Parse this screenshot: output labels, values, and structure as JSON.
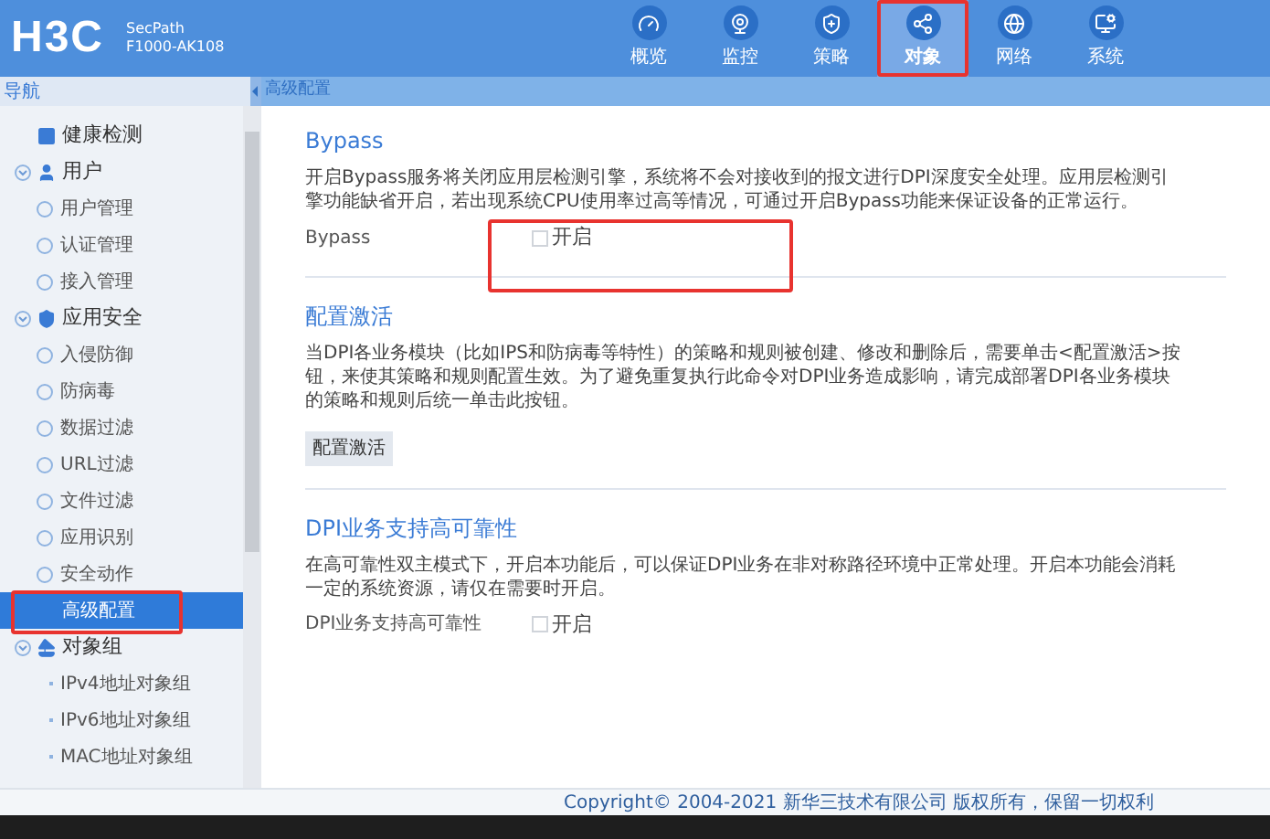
{
  "brand": {
    "logo": "H3C",
    "product_line": "SecPath",
    "model": "F1000-AK108"
  },
  "nav_tabs": [
    {
      "label": "概览",
      "selected": false
    },
    {
      "label": "监控",
      "selected": false
    },
    {
      "label": "策略",
      "selected": false
    },
    {
      "label": "对象",
      "selected": true
    },
    {
      "label": "网络",
      "selected": false
    },
    {
      "label": "系统",
      "selected": false
    }
  ],
  "sidebar": {
    "title": "导航",
    "items": [
      {
        "label": "健康检测",
        "selected": false
      },
      {
        "label": "用户",
        "expanded": true,
        "selected": false,
        "children": [
          {
            "label": "用户管理",
            "selected": false
          },
          {
            "label": "认证管理",
            "selected": false
          },
          {
            "label": "接入管理",
            "selected": false
          }
        ]
      },
      {
        "label": "应用安全",
        "expanded": true,
        "selected": false,
        "children": [
          {
            "label": "入侵防御",
            "selected": false
          },
          {
            "label": "防病毒",
            "selected": false
          },
          {
            "label": "数据过滤",
            "selected": false
          },
          {
            "label": "URL过滤",
            "selected": false
          },
          {
            "label": "文件过滤",
            "selected": false
          },
          {
            "label": "应用识别",
            "selected": false
          },
          {
            "label": "安全动作",
            "selected": false
          },
          {
            "label": "高级配置",
            "selected": true
          }
        ]
      },
      {
        "label": "对象组",
        "expanded": true,
        "selected": false,
        "children": [
          {
            "label": "IPv4地址对象组",
            "selected": false
          },
          {
            "label": "IPv6地址对象组",
            "selected": false
          },
          {
            "label": "MAC地址对象组",
            "selected": false
          }
        ]
      }
    ]
  },
  "breadcrumb": "高级配置",
  "sections": [
    {
      "title": "Bypass",
      "description": "开启Bypass服务将关闭应用层检测引擎，系统将不会对接收到的报文进行DPI深度安全处理。应用层检测引擎功能缺省开启，若出现系统CPU使用率过高等情况，可通过开启Bypass功能来保证设备的正常运行。",
      "kind": "checkbox",
      "field_label": "Bypass",
      "option": "开启",
      "checked": false
    },
    {
      "title": "配置激活",
      "description": "当DPI各业务模块（比如IPS和防病毒等特性）的策略和规则被创建、修改和删除后，需要单击<配置激活>按钮，来使其策略和规则配置生效。为了避免重复执行此命令对DPI业务造成影响，请完成部署DPI各业务模块的策略和规则后统一单击此按钮。",
      "kind": "button",
      "button": "配置激活"
    },
    {
      "title": "DPI业务支持高可靠性",
      "description": "在高可靠性双主模式下，开启本功能后，可以保证DPI业务在非对称路径环境中正常处理。开启本功能会消耗一定的系统资源，请仅在需要时开启。",
      "kind": "checkbox",
      "field_label": "DPI业务支持高可靠性",
      "option": "开启",
      "checked": false
    }
  ],
  "footer": "Copyright© 2004-2021 新华三技术有限公司 版权所有，保留一切权利"
}
